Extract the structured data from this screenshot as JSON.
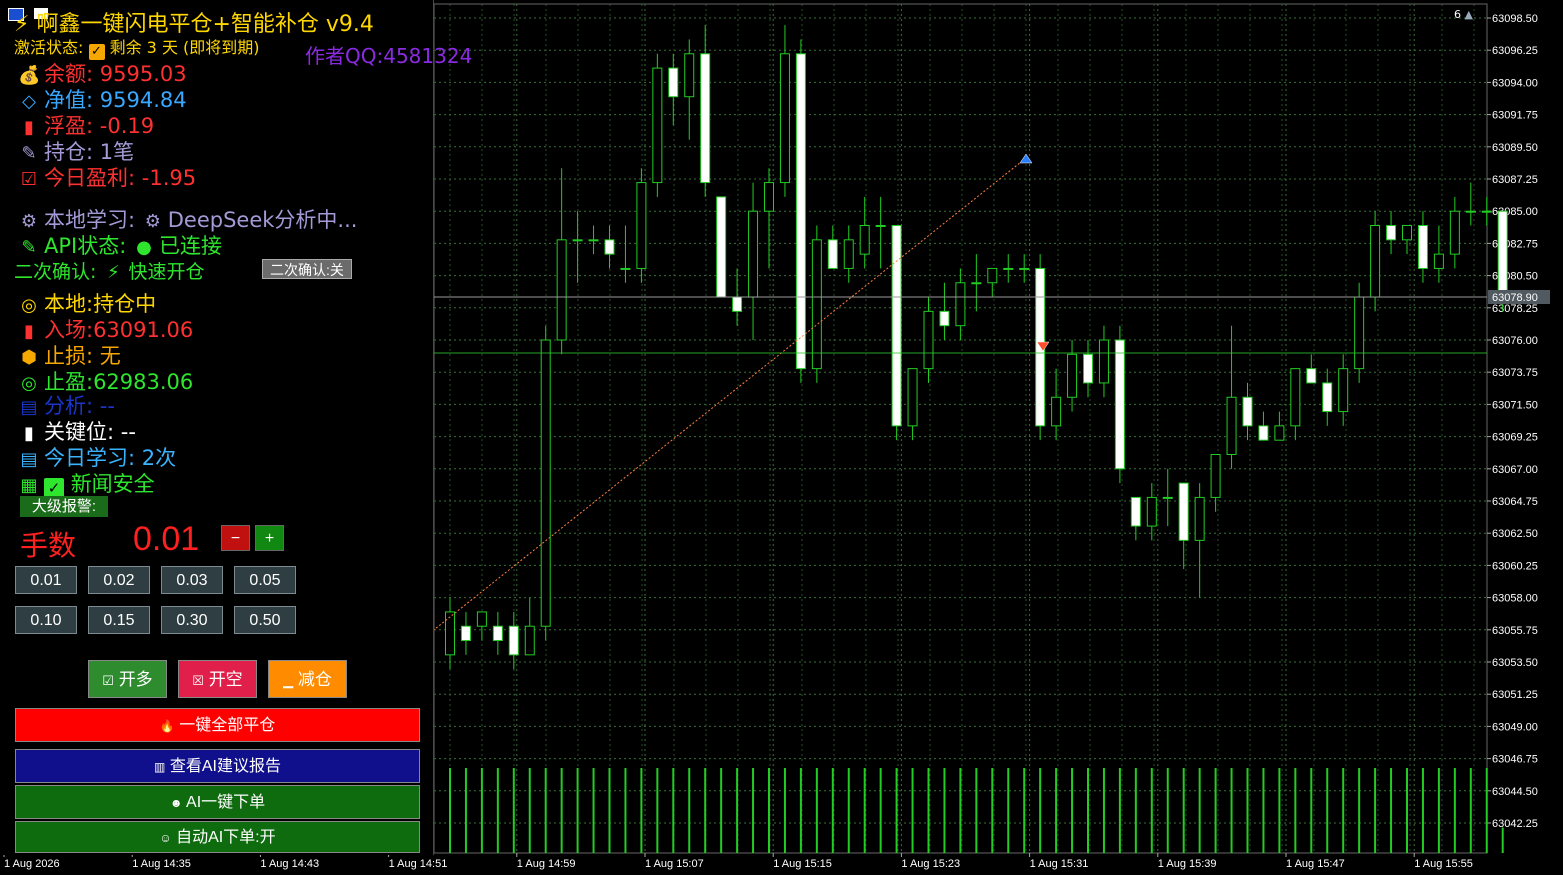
{
  "panel": {
    "title": "⚡ 啊鑫一键闪电平仓+智能补仓 v9.4",
    "author": "作者QQ:4581324",
    "activation_label": "激活状态:",
    "activation_remaining": "剩余 3 天 (即将到期)",
    "balance": "余额: 9595.03",
    "equity": "净值: 9594.84",
    "floating": "浮盈: -0.19",
    "positions": "持仓: 1笔",
    "today_profit": "今日盈利: -1.95",
    "local_learning": "本地学习:",
    "deepseek": "DeepSeek分析中...",
    "api_status": "API状态:",
    "api_connected": "已连接",
    "second_confirm": "二次确认:",
    "fast_open": "快速开仓",
    "second_confirm_btn": "二次确认:关",
    "local_state": "本地:持仓中",
    "entry": "入场:63091.06",
    "stop_loss": "止损: 无",
    "take_profit": "止盈:62983.06",
    "analysis": "分析: --",
    "key_level": "关键位: --",
    "today_learning": "今日学习: 2次",
    "news_safe": "新闻安全",
    "big_alert": "大级报警:",
    "lots_label": "手数",
    "lots_value": "0.01",
    "minus": "−",
    "plus": "+",
    "lot_buttons": [
      "0.01",
      "0.02",
      "0.03",
      "0.05",
      "0.10",
      "0.15",
      "0.30",
      "0.50"
    ],
    "buy": "开多",
    "sell": "开空",
    "reduce": "减仓",
    "close_all": "一键全部平仓",
    "ai_report": "查看AI建议报告",
    "ai_order": "AI一键下单",
    "auto_ai": "自动AI下单:开"
  },
  "chart": {
    "top_right_label": "6",
    "current_price_label": "63078.90",
    "price_labels": [
      "63098.50",
      "63096.25",
      "63094.00",
      "63091.75",
      "63089.50",
      "63087.25",
      "63085.00",
      "63082.75",
      "63080.50",
      "63078.25",
      "63076.00",
      "63073.75",
      "63071.50",
      "63069.25",
      "63067.00",
      "63064.75",
      "63062.50",
      "63060.25",
      "63058.00",
      "63055.75",
      "63053.50",
      "63051.25",
      "63049.00",
      "63046.75",
      "63044.50",
      "63042.25"
    ],
    "time_labels": [
      "1 Aug 2026",
      "1 Aug 14:35",
      "1 Aug 14:43",
      "1 Aug 14:51",
      "1 Aug 14:59",
      "1 Aug 15:07",
      "1 Aug 15:15",
      "1 Aug 15:23",
      "1 Aug 15:31",
      "1 Aug 15:39",
      "1 Aug 15:47",
      "1 Aug 15:55"
    ],
    "colors": {
      "grid": "#3a6e3a",
      "bull": "#000000",
      "bear": "#ffffff",
      "wick": "#22cc22",
      "volume": "#22cc22",
      "dotted": "#ff8040"
    },
    "candles": [
      {
        "o": 63054,
        "h": 63058,
        "l": 63053,
        "c": 63057
      },
      {
        "o": 63056,
        "h": 63057,
        "l": 63054,
        "c": 63055
      },
      {
        "o": 63056,
        "h": 63057,
        "l": 63055,
        "c": 63057
      },
      {
        "o": 63056,
        "h": 63057,
        "l": 63054,
        "c": 63055
      },
      {
        "o": 63056,
        "h": 63057,
        "l": 63053,
        "c": 63054
      },
      {
        "o": 63054,
        "h": 63058,
        "l": 63054,
        "c": 63056
      },
      {
        "o": 63056,
        "h": 63077,
        "l": 63055,
        "c": 63076
      },
      {
        "o": 63076,
        "h": 63088,
        "l": 63075,
        "c": 63083
      },
      {
        "o": 63083,
        "h": 63085,
        "l": 63080,
        "c": 63083
      },
      {
        "o": 63083,
        "h": 63084,
        "l": 63082,
        "c": 63083
      },
      {
        "o": 63083,
        "h": 63084,
        "l": 63081,
        "c": 63082
      },
      {
        "o": 63081,
        "h": 63084,
        "l": 63080,
        "c": 63081
      },
      {
        "o": 63081,
        "h": 63088,
        "l": 63080,
        "c": 63087
      },
      {
        "o": 63087,
        "h": 63096,
        "l": 63086,
        "c": 63095
      },
      {
        "o": 63095,
        "h": 63096,
        "l": 63091,
        "c": 63093
      },
      {
        "o": 63093,
        "h": 63097,
        "l": 63090,
        "c": 63096
      },
      {
        "o": 63096,
        "h": 63098,
        "l": 63086,
        "c": 63087
      },
      {
        "o": 63086,
        "h": 63086,
        "l": 63079,
        "c": 63079
      },
      {
        "o": 63079,
        "h": 63081,
        "l": 63077,
        "c": 63078
      },
      {
        "o": 63079,
        "h": 63087,
        "l": 63076,
        "c": 63085
      },
      {
        "o": 63085,
        "h": 63088,
        "l": 63081,
        "c": 63087
      },
      {
        "o": 63087,
        "h": 63098,
        "l": 63086,
        "c": 63096
      },
      {
        "o": 63096,
        "h": 63097,
        "l": 63073,
        "c": 63074
      },
      {
        "o": 63074,
        "h": 63084,
        "l": 63073,
        "c": 63083
      },
      {
        "o": 63083,
        "h": 63084,
        "l": 63081,
        "c": 63081
      },
      {
        "o": 63081,
        "h": 63084,
        "l": 63080,
        "c": 63083
      },
      {
        "o": 63082,
        "h": 63086,
        "l": 63081,
        "c": 63084
      },
      {
        "o": 63084,
        "h": 63086,
        "l": 63081,
        "c": 63084
      },
      {
        "o": 63084,
        "h": 63084,
        "l": 63069,
        "c": 63070
      },
      {
        "o": 63070,
        "h": 63074,
        "l": 63069,
        "c": 63074
      },
      {
        "o": 63074,
        "h": 63079,
        "l": 63073,
        "c": 63078
      },
      {
        "o": 63078,
        "h": 63080,
        "l": 63076,
        "c": 63077
      },
      {
        "o": 63077,
        "h": 63081,
        "l": 63076,
        "c": 63080
      },
      {
        "o": 63080,
        "h": 63082,
        "l": 63078,
        "c": 63080
      },
      {
        "o": 63080,
        "h": 63081,
        "l": 63079,
        "c": 63081
      },
      {
        "o": 63081,
        "h": 63082,
        "l": 63080,
        "c": 63081
      },
      {
        "o": 63081,
        "h": 63082,
        "l": 63080,
        "c": 63081
      },
      {
        "o": 63081,
        "h": 63082,
        "l": 63069,
        "c": 63070
      },
      {
        "o": 63070,
        "h": 63074,
        "l": 63069,
        "c": 63072
      },
      {
        "o": 63072,
        "h": 63076,
        "l": 63071,
        "c": 63075
      },
      {
        "o": 63075,
        "h": 63076,
        "l": 63072,
        "c": 63073
      },
      {
        "o": 63073,
        "h": 63077,
        "l": 63072,
        "c": 63076
      },
      {
        "o": 63076,
        "h": 63077,
        "l": 63066,
        "c": 63067
      },
      {
        "o": 63065,
        "h": 63065,
        "l": 63062,
        "c": 63063
      },
      {
        "o": 63063,
        "h": 63066,
        "l": 63062,
        "c": 63065
      },
      {
        "o": 63065,
        "h": 63067,
        "l": 63063,
        "c": 63065
      },
      {
        "o": 63066,
        "h": 63066,
        "l": 63060,
        "c": 63062
      },
      {
        "o": 63062,
        "h": 63066,
        "l": 63058,
        "c": 63065
      },
      {
        "o": 63065,
        "h": 63068,
        "l": 63064,
        "c": 63068
      },
      {
        "o": 63068,
        "h": 63077,
        "l": 63067,
        "c": 63072
      },
      {
        "o": 63072,
        "h": 63073,
        "l": 63069,
        "c": 63070
      },
      {
        "o": 63070,
        "h": 63071,
        "l": 63069,
        "c": 63069
      },
      {
        "o": 63069,
        "h": 63071,
        "l": 63069,
        "c": 63070
      },
      {
        "o": 63070,
        "h": 63073,
        "l": 63069,
        "c": 63074
      },
      {
        "o": 63074,
        "h": 63075,
        "l": 63073,
        "c": 63073
      },
      {
        "o": 63073,
        "h": 63074,
        "l": 63070,
        "c": 63071
      },
      {
        "o": 63071,
        "h": 63075,
        "l": 63070,
        "c": 63074
      },
      {
        "o": 63074,
        "h": 63080,
        "l": 63073,
        "c": 63079
      },
      {
        "o": 63079,
        "h": 63085,
        "l": 63078,
        "c": 63084
      },
      {
        "o": 63084,
        "h": 63085,
        "l": 63082,
        "c": 63083
      },
      {
        "o": 63083,
        "h": 63084,
        "l": 63082,
        "c": 63084
      },
      {
        "o": 63084,
        "h": 63085,
        "l": 63080,
        "c": 63081
      },
      {
        "o": 63081,
        "h": 63084,
        "l": 63080,
        "c": 63082
      },
      {
        "o": 63082,
        "h": 63086,
        "l": 63081,
        "c": 63085
      },
      {
        "o": 63085,
        "h": 63087,
        "l": 63084,
        "c": 63085
      },
      {
        "o": 63085,
        "h": 63086,
        "l": 63084,
        "c": 63085
      },
      {
        "o": 63085,
        "h": 63085,
        "l": 63078,
        "c": 63079
      }
    ],
    "volumes": [
      10,
      10,
      10,
      10,
      10,
      10,
      10,
      10,
      10,
      10,
      10,
      10,
      10,
      10,
      10,
      10,
      10,
      10,
      10,
      10,
      10,
      10,
      10,
      10,
      10,
      10,
      10,
      10,
      10,
      10,
      10,
      10,
      10,
      10,
      10,
      10,
      10,
      10,
      10,
      10,
      10,
      10,
      10,
      10,
      10,
      10,
      10,
      10,
      10,
      10,
      10,
      10,
      10,
      10,
      10,
      10,
      10,
      10,
      10,
      10,
      10,
      10,
      10,
      10,
      10,
      10,
      3
    ]
  }
}
